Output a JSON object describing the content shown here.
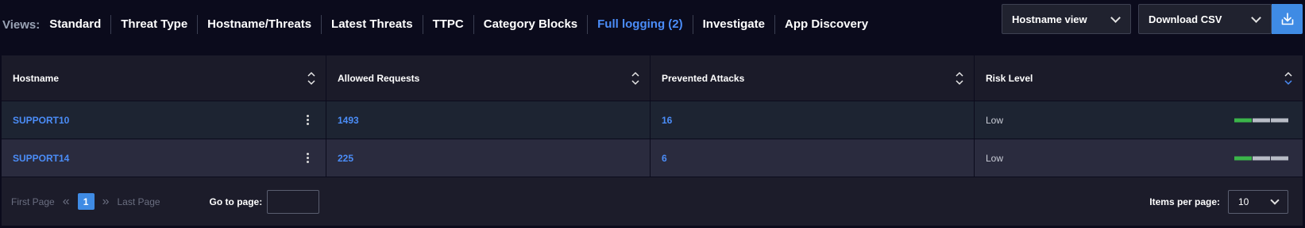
{
  "views": {
    "label": "Views:",
    "items": [
      {
        "label": "Standard",
        "active": false
      },
      {
        "label": "Threat Type",
        "active": false
      },
      {
        "label": "Hostname/Threats",
        "active": false
      },
      {
        "label": "Latest Threats",
        "active": false
      },
      {
        "label": "TTPC",
        "active": false
      },
      {
        "label": "Category Blocks",
        "active": false
      },
      {
        "label": "Full logging (2)",
        "active": true
      },
      {
        "label": "Investigate",
        "active": false
      },
      {
        "label": "App Discovery",
        "active": false
      }
    ]
  },
  "toolbar": {
    "view_select": "Hostname view",
    "export_select": "Download CSV",
    "download_icon": "download-icon"
  },
  "table": {
    "headers": [
      "Hostname",
      "Allowed Requests",
      "Prevented Attacks",
      "Risk Level"
    ],
    "rows": [
      {
        "hostname": "SUPPORT10",
        "allowed": "1493",
        "prevented": "16",
        "risk": "Low",
        "risk_level": 1,
        "risk_max": 3
      },
      {
        "hostname": "SUPPORT14",
        "allowed": "225",
        "prevented": "6",
        "risk": "Low",
        "risk_level": 1,
        "risk_max": 3
      }
    ]
  },
  "pagination": {
    "first": "First Page",
    "last": "Last Page",
    "current": "1",
    "goto_label": "Go to page:",
    "goto_value": "",
    "items_label": "Items per page:",
    "items_value": "10"
  },
  "colors": {
    "accent": "#4b8df8",
    "risk_on": "#3bb54a",
    "risk_off": "#b8bcc6"
  }
}
